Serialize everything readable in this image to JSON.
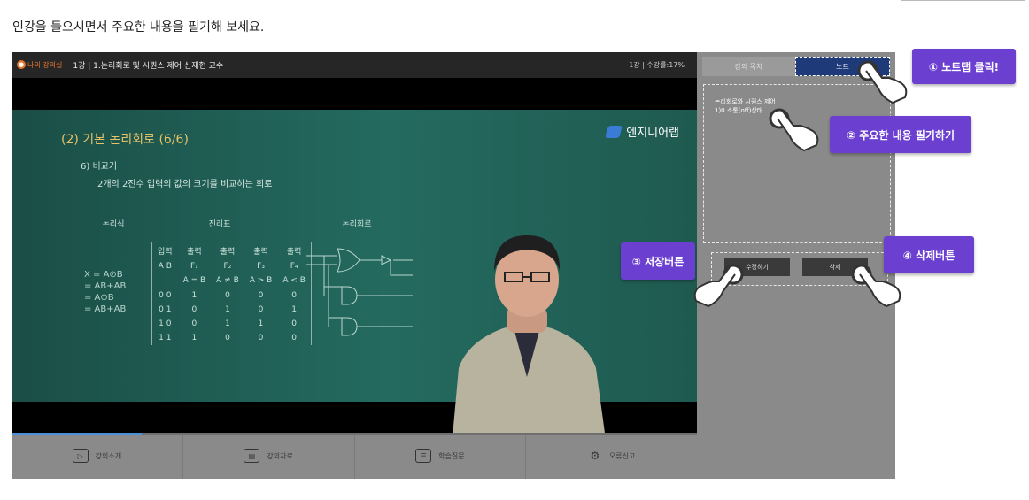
{
  "instruction": "인강을 들으시면서 주요한 내용을 필기해 보세요.",
  "player": {
    "my_room_badge": "나의 강의실",
    "lecture_title": "1강 | 1.논리회로 및 시퀀스 제어 신재현 교수",
    "progress_text": "1강 | 수강률:17%"
  },
  "slide": {
    "title": "(2) 기본 논리회로 (6/6)",
    "brand": "엔지니어랩",
    "sub1": "6) 비교기",
    "sub2": "2개의 2진수 입력의 값의 크기를 비교하는 회로",
    "table_headers": [
      "논리식",
      "진리표",
      "논리회로"
    ],
    "truth_header": [
      "입력",
      "출력",
      "출력",
      "출력",
      "출력"
    ],
    "truth_sub": [
      "A  B",
      "F₁",
      "F₂",
      "F₃",
      "F₄"
    ],
    "truth_cond": [
      "",
      "A = B",
      "A ≠ B",
      "A > B",
      "A < B"
    ],
    "truth_rows": [
      [
        "0  0",
        "1",
        "0",
        "0",
        "0"
      ],
      [
        "0  1",
        "0",
        "1",
        "0",
        "1"
      ],
      [
        "1  0",
        "0",
        "1",
        "1",
        "0"
      ],
      [
        "1  1",
        "1",
        "0",
        "0",
        "0"
      ]
    ],
    "formula": [
      "X = A⊙B",
      "= AB+AB",
      "= A⊙B",
      "= AB+AB"
    ]
  },
  "controls": {
    "items": [
      {
        "label": "강의소개",
        "icon": "▷"
      },
      {
        "label": "강의자료",
        "icon": "▤"
      },
      {
        "label": "학습질문",
        "icon": "☰"
      },
      {
        "label": "오류신고",
        "icon": "⚙"
      }
    ],
    "progress_fraction": 0.19
  },
  "side": {
    "tab_toc": "강의 목차",
    "tab_note": "노트",
    "note_text": "논리회로와 시퀀스 제어\n1)0 소통(off)상태",
    "edit_button": "수정하기",
    "delete_button": "삭제"
  },
  "callouts": {
    "c1": "① 노트탭 클릭!",
    "c2": "② 주요한 내용 필기하기",
    "c3": "③ 저장버튼",
    "c4": "④ 삭제버튼"
  },
  "colors": {
    "accent_purple": "#6b3fd0",
    "note_tab": "#1e3a78",
    "slide_green": "#246a5f"
  }
}
